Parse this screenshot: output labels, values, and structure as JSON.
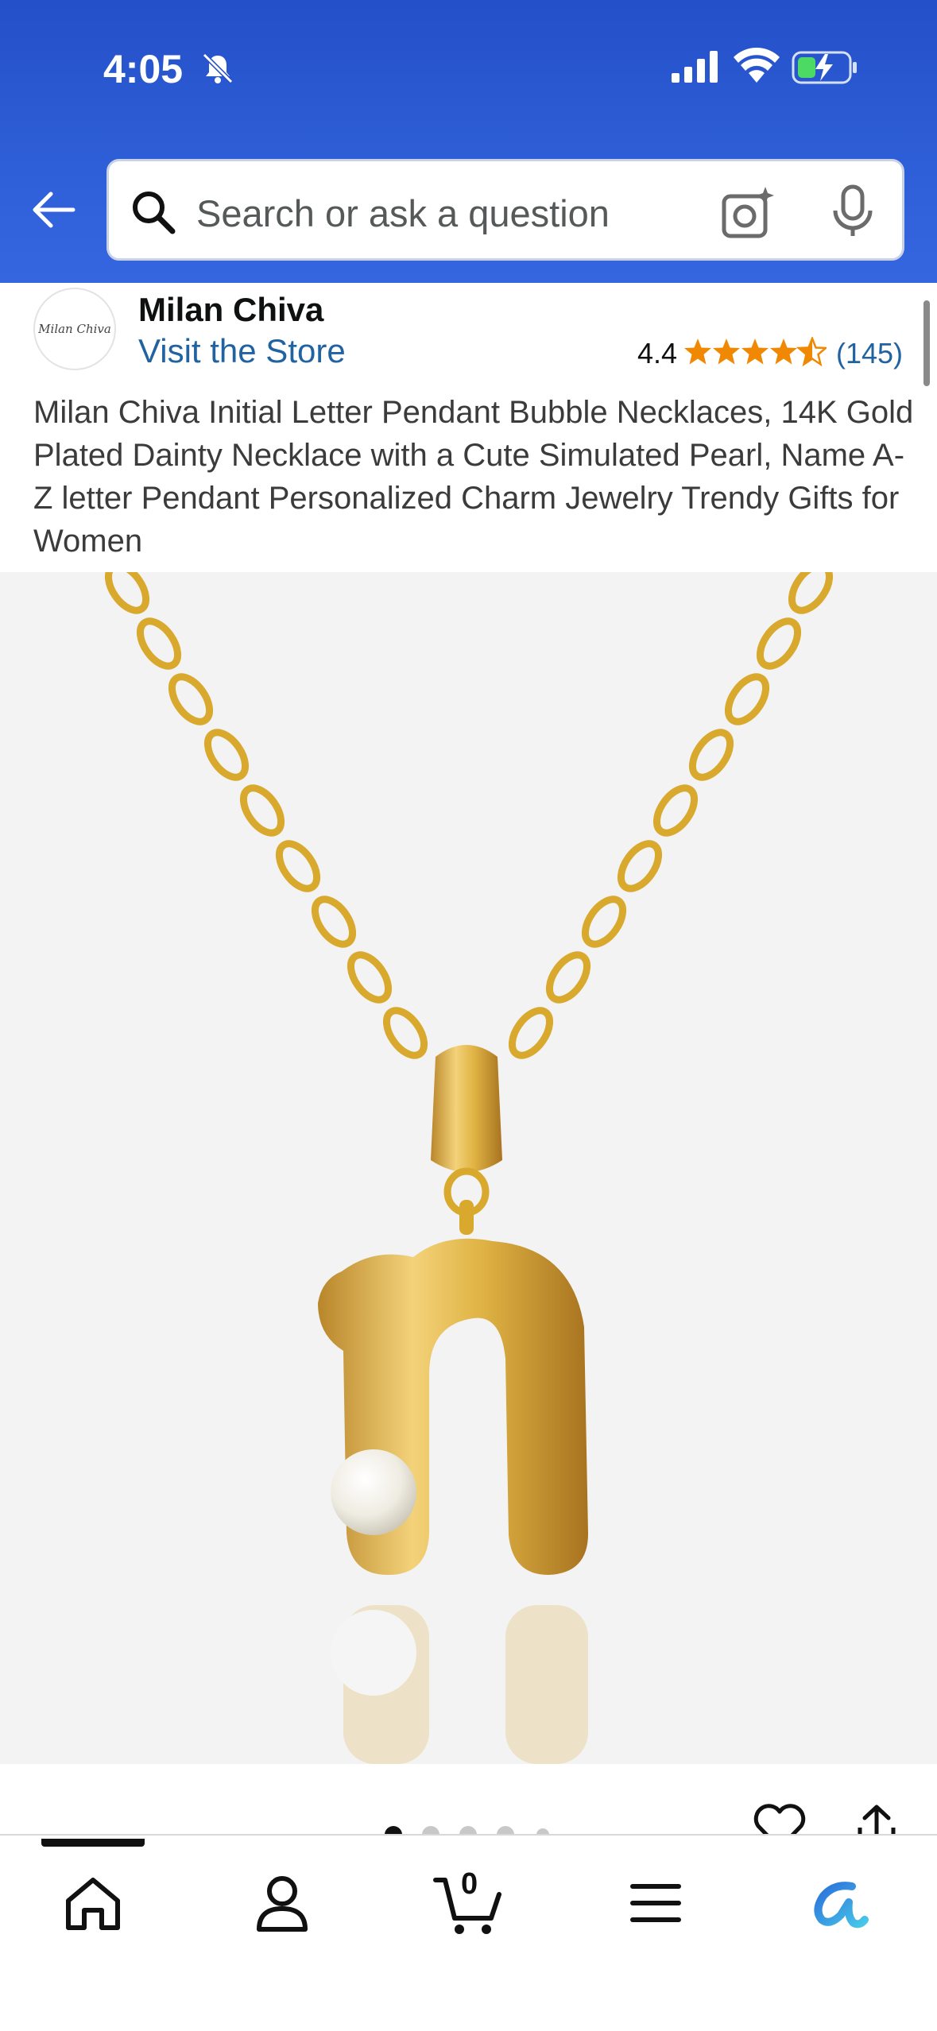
{
  "status_bar": {
    "time": "4:05"
  },
  "search": {
    "placeholder": "Search or ask a question"
  },
  "store": {
    "logo_text": "Milan Chiva",
    "name": "Milan Chiva",
    "visit_label": "Visit the Store",
    "rating": "4.4",
    "stars_fraction": 0.88,
    "review_count": "(145)"
  },
  "product": {
    "title": "Milan Chiva Initial Letter Pendant Bubble Necklaces, 14K Gold Plated Dainty Necklace with a Cute Simulated Pearl, Name A-Z letter Pendant Personalized Charm Jewelry Trendy Gifts for Women"
  },
  "carousel": {
    "total": 5,
    "active": 1
  },
  "bottom_nav": {
    "items": [
      "home-icon",
      "account-icon",
      "cart-icon",
      "menu-icon",
      "rufus-icon"
    ],
    "cart_count": "0"
  },
  "colors": {
    "header": "#2450c8",
    "link": "#2162a1",
    "star": "#f08804",
    "gold": "#d9a92e"
  }
}
